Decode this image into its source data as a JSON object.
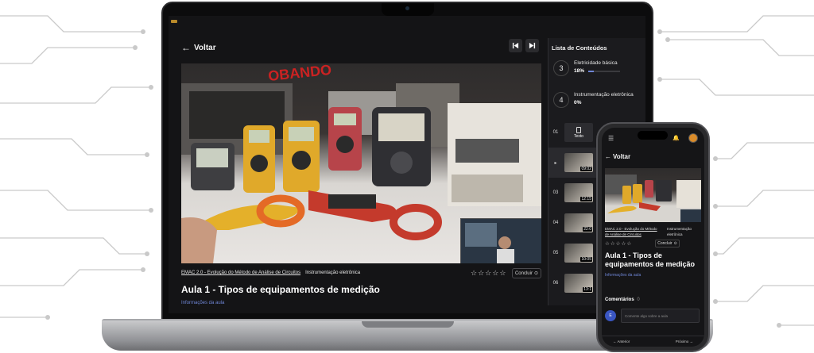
{
  "player": {
    "back_label": "Voltar",
    "breadcrumb_course": "EMAC 2.0 - Evolução do Método de Análise de Circuitos",
    "breadcrumb_module": "Instrumentação eletrônica",
    "conclude_label": "Concluir",
    "lesson_title": "Aula 1 - Tipos de equipamentos de medição",
    "lesson_info_label": "Informações da aula",
    "rating": {
      "stars_max": 5,
      "value": 0
    }
  },
  "playlist": {
    "title": "Lista de Conteúdos",
    "sections": [
      {
        "number": "3",
        "name": "Eletricidade básica",
        "progress": "18%",
        "progress_value": 18
      },
      {
        "number": "4",
        "name": "Instrumentação eletrônica",
        "progress": "0%",
        "progress_value": 0
      }
    ],
    "lessons": [
      {
        "number": "01",
        "kind": "text",
        "label": "Texto"
      },
      {
        "number": "",
        "kind": "video",
        "time": "09:02",
        "active": true
      },
      {
        "number": "03",
        "kind": "video",
        "time": "12:15"
      },
      {
        "number": "04",
        "kind": "video",
        "time": "22:0"
      },
      {
        "number": "05",
        "kind": "video",
        "time": "10:05"
      },
      {
        "number": "06",
        "kind": "video",
        "time": "13:1"
      }
    ]
  },
  "phone": {
    "back_label": "Voltar",
    "breadcrumb_course": "EMAC 2.0 - Evolução do Método de Análise de Circuitos",
    "breadcrumb_module": "Instrumentação eletrônica",
    "conclude_label": "Concluir",
    "lesson_title": "Aula 1 - Tipos de equipamentos de medição",
    "lesson_info_label": "Informações da aula",
    "comments_label": "Comentários",
    "comments_count": "0",
    "comment_avatar_initials": "E",
    "comment_placeholder": "Comente algo sobre a aula",
    "prev_label": "← Anterior",
    "next_label": "Próximo →"
  },
  "colors": {
    "accent": "#6f86d6",
    "background": "#141416",
    "panel": "#1b1b1e"
  }
}
